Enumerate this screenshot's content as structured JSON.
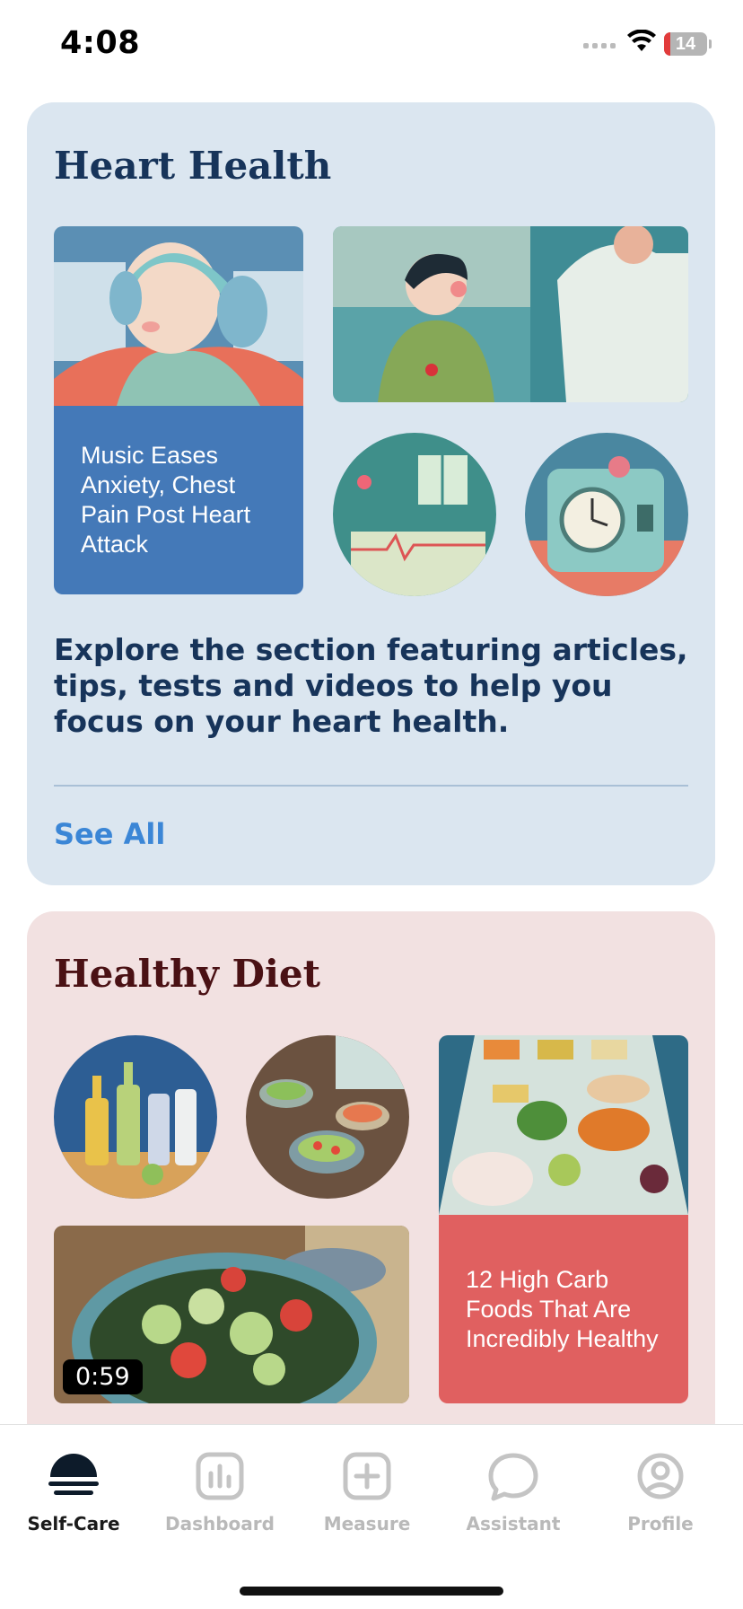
{
  "status_bar": {
    "time": "4:08",
    "battery_level": "14",
    "battery_fraction": 0.14,
    "battery_color": "#e23b3b"
  },
  "heart_health": {
    "title": "Heart Health",
    "feature_caption": "Music Eases Anxiety, Chest Pain Post Heart Attack",
    "description": "Explore the section featuring articles, tips, tests and videos to help you focus on your heart health.",
    "see_all": "See All",
    "accent_color": "#4479b8",
    "background_color": "#dbe6f0"
  },
  "healthy_diet": {
    "title": "Healthy Diet",
    "feature_caption": "12 High Carb Foods That Are Incredibly Healthy",
    "video_duration": "0:59",
    "accent_color": "#e06060",
    "background_color": "#f2e1e1"
  },
  "tab_bar": {
    "tabs": [
      {
        "label": "Self-Care",
        "icon": "self-care-icon",
        "active": true
      },
      {
        "label": "Dashboard",
        "icon": "bar-chart-icon",
        "active": false
      },
      {
        "label": "Measure",
        "icon": "plus-square-icon",
        "active": false
      },
      {
        "label": "Assistant",
        "icon": "chat-bubble-icon",
        "active": false
      },
      {
        "label": "Profile",
        "icon": "person-circle-icon",
        "active": false
      }
    ]
  }
}
